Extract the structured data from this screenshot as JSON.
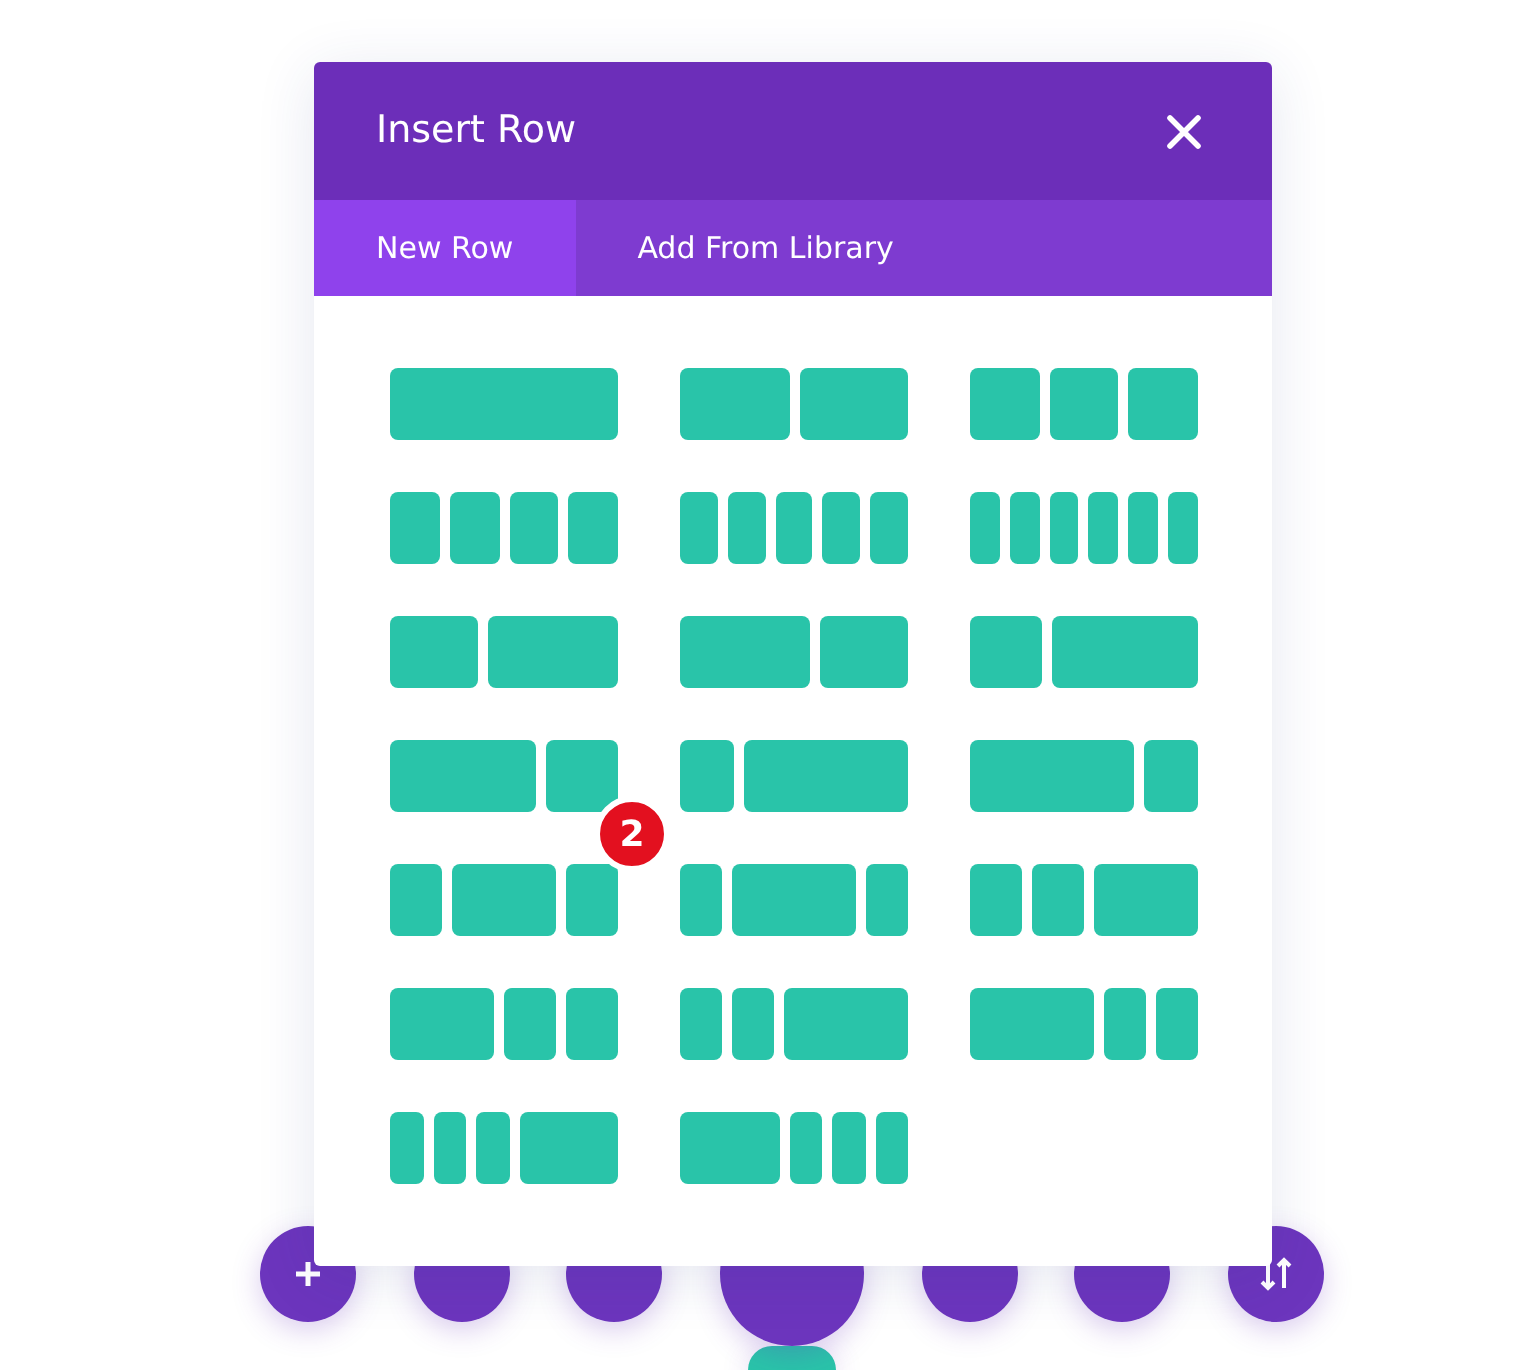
{
  "dialog": {
    "title": "Insert Row"
  },
  "tabs": [
    {
      "label": "New Row",
      "selected": true
    },
    {
      "label": "Add From Library",
      "selected": false
    }
  ],
  "layouts": [
    {
      "kind": "full"
    },
    {
      "kind": "halves"
    },
    {
      "kind": "thirds"
    },
    {
      "kind": "quarters"
    },
    {
      "kind": "fifths"
    },
    {
      "kind": "sixths"
    },
    {
      "kind": "twothree"
    },
    {
      "kind": "threetwo"
    },
    {
      "kind": "onetwo"
    },
    {
      "kind": "twoone"
    },
    {
      "kind": "onethree"
    },
    {
      "kind": "threeone"
    },
    {
      "kind": "onetwoone"
    },
    {
      "kind": "onethreeone"
    },
    {
      "kind": "oneonetwo"
    },
    {
      "kind": "twooneone"
    },
    {
      "kind": "oneonethree"
    },
    {
      "kind": "threeoneone"
    },
    {
      "kind": "oneoneonethree"
    },
    {
      "kind": "threeoneoneone"
    }
  ],
  "badge": "2"
}
